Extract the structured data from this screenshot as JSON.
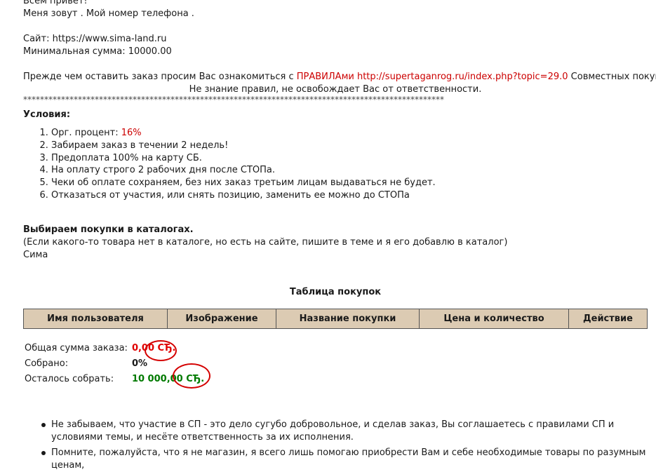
{
  "intro": {
    "greeting": "Всем привет!",
    "name_phone": "Меня зовут . Мой номер телефона ."
  },
  "site": {
    "label": "Сайт: ",
    "url": "https://www.sima-land.ru",
    "min_sum": "Минимальная сумма: 10000.00"
  },
  "rules_notice": {
    "prefix": "Прежде чем оставить заказ просим Вас ознакомиться с ",
    "rules_link": "ПРАВИЛАми",
    "rules_url": "http://supertaganrog.ru/index.php?topic=29.0",
    "suffix": " Совместных покупок.",
    "line2": "Не знание правил, не освобождает Вас от ответственности."
  },
  "divider": "****************************************************************************************************",
  "conditions": {
    "title": "Условия:",
    "items": [
      {
        "text": "Орг. процент: ",
        "highlight": "16%"
      },
      {
        "text": "Забираем заказ в течении 2 недель!",
        "highlight": ""
      },
      {
        "text": "Предоплата 100% на карту СБ.",
        "highlight": ""
      },
      {
        "text": "На оплату строго 2 рабочих дня после СТОПа.",
        "highlight": ""
      },
      {
        "text": "Чеки об оплате сохраняем, без них заказ третьим лицам выдаваться не будет.",
        "highlight": ""
      },
      {
        "text": "Отказаться от участия, или снять позицию, заменить ее можно до СТОПа",
        "highlight": ""
      }
    ]
  },
  "catalog": {
    "title": "Выбираем покупки в каталогах.",
    "note": "(Если какого-то товара нет в каталоге, но есть на сайте, пишите в теме и я его добавлю в каталог)",
    "link": "Сима"
  },
  "table": {
    "title": "Таблица покупок",
    "headers": [
      "Имя пользователя",
      "Изображение",
      "Название покупки",
      "Цена и количество",
      "Действие"
    ]
  },
  "totals": {
    "order_total_label": "Общая сумма заказа:",
    "order_total_value": "0,00 СЂ.",
    "collected_label": "Собрано:",
    "collected_value": "0%",
    "remaining_label": "Осталось собрать:",
    "remaining_value": "10 000,00 СЂ."
  },
  "notes": [
    "Не забываем, что участие в СП - это дело сугубо добровольное, и сделав заказ, Вы соглашаетесь с правилами СП и условиями темы, и несёте ответственность за их исполнения.",
    "Помните, пожалуйста, что я не магазин, я всего лишь помогаю приобрести Вам и себе необходимые товары по разумным ценам,"
  ],
  "colors": {
    "accent_red": "#cc0000",
    "header_bg": "#dccbb3",
    "green": "#007a00",
    "annotation_circle": "#d40000"
  }
}
